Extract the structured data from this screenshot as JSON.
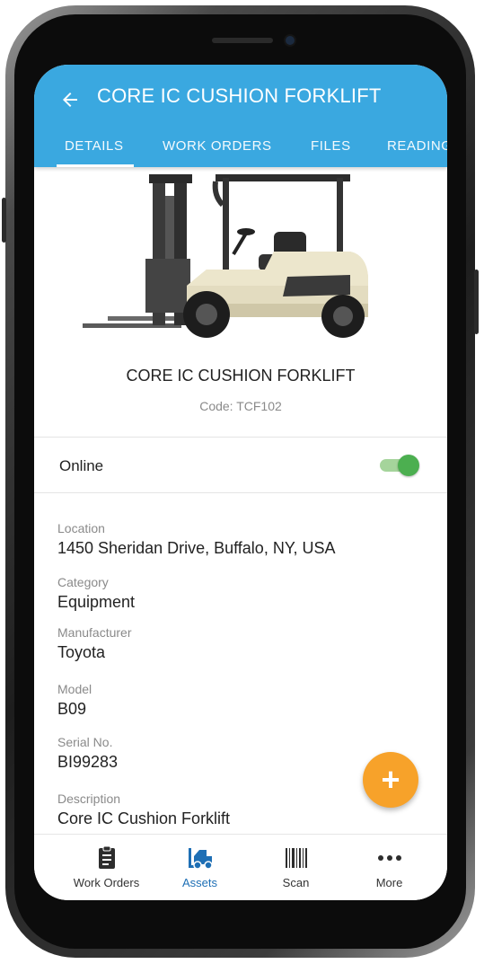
{
  "appbar": {
    "title": "CORE IC CUSHION FORKLIFT",
    "tabs": [
      {
        "label": "DETAILS",
        "active": true
      },
      {
        "label": "WORK ORDERS",
        "active": false
      },
      {
        "label": "FILES",
        "active": false
      },
      {
        "label": "READINGS",
        "active": false
      }
    ]
  },
  "asset": {
    "name": "CORE IC CUSHION FORKLIFT",
    "code": "Code: TCF102",
    "online_label": "Online",
    "online": true
  },
  "fields": [
    {
      "label": "Location",
      "value": "1450 Sheridan Drive, Buffalo, NY, USA"
    },
    {
      "label": "Category",
      "value": "Equipment"
    },
    {
      "label": "Manufacturer",
      "value": "Toyota"
    },
    {
      "label": "Model",
      "value": "B09"
    },
    {
      "label": "Serial No.",
      "value": "BI99283"
    },
    {
      "label": "Description",
      "value": "Core IC Cushion Forklift"
    }
  ],
  "fab": {
    "symbol": "+",
    "icon": "plus-icon"
  },
  "bottom_nav": [
    {
      "label": "Work Orders",
      "icon": "clipboard-icon",
      "active": false
    },
    {
      "label": "Assets",
      "icon": "forklift-icon",
      "active": true
    },
    {
      "label": "Scan",
      "icon": "barcode-icon",
      "active": false
    },
    {
      "label": "More",
      "icon": "more-dots-icon",
      "active": false
    }
  ],
  "colors": {
    "appbar": "#3aa8e0",
    "fab": "#f7a22a",
    "toggle_on": "#4caf50",
    "nav_active": "#1e6fb5"
  }
}
